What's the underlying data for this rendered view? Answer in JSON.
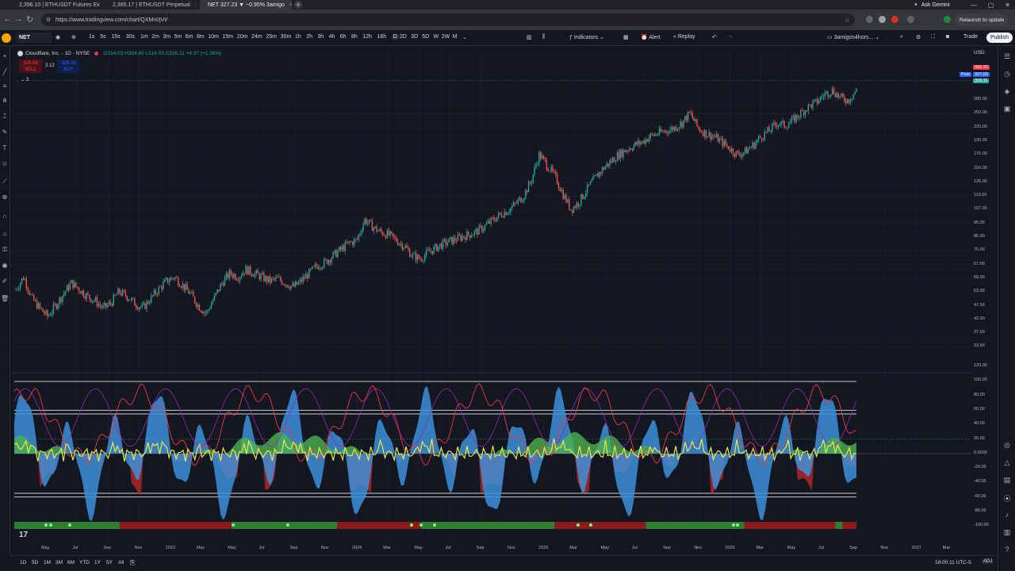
{
  "browser": {
    "tabs": [
      {
        "label": "2,396.10 | ETHUSDT Futures Ex",
        "active": false,
        "favicon_color": "#f0b90b"
      },
      {
        "label": "2,395.17 | ETHUSDT Perpetual",
        "active": false,
        "favicon_color": "#2ebd85"
      },
      {
        "label": "NET 327.23 ▼ −0.95% 3amigo",
        "active": true,
        "favicon_color": "#ffffff"
      }
    ],
    "tab_close": "×",
    "new_tab": "+",
    "ask_gemini": "Ask Gemini",
    "url": "https://www.tradingview.com/chart/QXMn0jVt/",
    "relaunch": "Relaunch to update"
  },
  "toolbar": {
    "symbol": "NET",
    "timeframes": [
      "1s",
      "5s",
      "15s",
      "30s",
      "1m",
      "2m",
      "3m",
      "5m",
      "6m",
      "8m",
      "10m",
      "15m",
      "20m",
      "24m",
      "25m",
      "30m",
      "1h",
      "2h",
      "3h",
      "4h",
      "6h",
      "8h",
      "12h",
      "16h",
      "D",
      "2D",
      "3D",
      "5D",
      "W",
      "2W",
      "M"
    ],
    "active_timeframe": "D",
    "indicators": "Indicators",
    "alert": "Alert",
    "replay": "Replay",
    "layout_name": "3amigos4hors...",
    "trade": "Trade",
    "publish": "Publish"
  },
  "legend": {
    "title": "Cloudflare, Inc. · 1D · NYSE",
    "ohlc": "O314.03 H334.60 L314.03 C326.11 +4.37 (+1.36%)",
    "sell_price": "326.88",
    "sell_label": "SELL",
    "spread": "3.12",
    "buy_price": "329.00",
    "buy_label": "BUY",
    "indicator_count": "3"
  },
  "price_axis": {
    "currency": "USD",
    "labels": [
      "280.00",
      "250.00",
      "220.00",
      "190.00",
      "170.00",
      "150.00",
      "135.00",
      "119.00",
      "107.00",
      "95.00",
      "85.00",
      "75.00",
      "67.00",
      "59.00",
      "53.00",
      "47.00",
      "42.00",
      "37.50",
      "33.50"
    ],
    "tags": [
      {
        "label": "332.23",
        "color": "#f23645"
      },
      {
        "label": "327.03",
        "color": "#2962ff"
      },
      {
        "label": "326.11",
        "color": "#26a69a"
      }
    ],
    "post_label": "Post"
  },
  "osc_axis": {
    "labels": [
      "120.00",
      "100.00",
      "80.00",
      "60.00",
      "40.00",
      "20.00",
      "0.0000",
      "-20.00",
      "-40.00",
      "-60.00",
      "-80.00",
      "-100.00"
    ]
  },
  "time_axis": {
    "labels": [
      "May",
      "Jul",
      "Sep",
      "Nov",
      "2023",
      "Mar",
      "May",
      "Jul",
      "Sep",
      "Nov",
      "2024",
      "Mar",
      "May",
      "Jul",
      "Sep",
      "Nov",
      "2025",
      "Mar",
      "May",
      "Jul",
      "Sep",
      "Nov",
      "2026",
      "Mar",
      "May",
      "Jul",
      "Sep",
      "Nov",
      "2027",
      "Mar"
    ]
  },
  "bottom": {
    "ranges": [
      "1D",
      "5D",
      "1M",
      "3M",
      "6M",
      "YTD",
      "1Y",
      "5Y",
      "All"
    ],
    "clock": "18:00:11 UTC-5",
    "adj": "ADJ"
  },
  "colors": {
    "up": "#26a69a",
    "down": "#ef5350",
    "osc_blue": "#3d8fd8",
    "osc_green": "#4caf50",
    "osc_red": "#c62828",
    "osc_yellow": "#e8e84a",
    "accent": "#2962ff"
  },
  "price_series": [
    52,
    58,
    48,
    44,
    41,
    45,
    50,
    55,
    52,
    49,
    47,
    44,
    46,
    51,
    49,
    46,
    44,
    48,
    52,
    56,
    58,
    54,
    50,
    45,
    42,
    48,
    55,
    60,
    58,
    62,
    60,
    58,
    56,
    57,
    55,
    53,
    56,
    60,
    64,
    66,
    70,
    74,
    78,
    80,
    96,
    90,
    86,
    84,
    80,
    76,
    70,
    68,
    72,
    75,
    78,
    80,
    82,
    84,
    86,
    90,
    95,
    100,
    104,
    110,
    118,
    135,
    170,
    155,
    140,
    120,
    105,
    112,
    125,
    138,
    150,
    160,
    170,
    178,
    185,
    190,
    200,
    205,
    210,
    215,
    225,
    245,
    215,
    205,
    200,
    190,
    180,
    170,
    175,
    185,
    200,
    210,
    225,
    220,
    230,
    245,
    260,
    270,
    290,
    300,
    280,
    275,
    300
  ]
}
